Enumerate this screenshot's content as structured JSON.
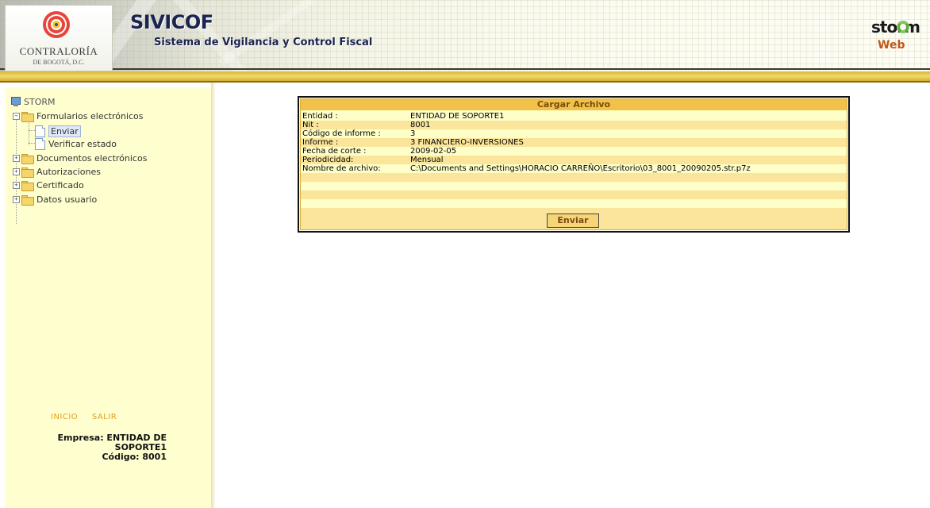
{
  "header": {
    "logo_name": "CONTRALORÍA",
    "logo_city": "DE BOGOTÁ, D.C.",
    "app_title": "SIVICOF",
    "app_subtitle": "Sistema de Vigilancia y Control Fiscal",
    "storm_word": "storm",
    "storm_web": "Web"
  },
  "sidebar": {
    "root": "STORM",
    "items": [
      {
        "label": "Formularios electrónicos",
        "icon": "folder-open-icon",
        "expanded": true
      },
      {
        "label": "Enviar",
        "icon": "document-icon",
        "selected": true
      },
      {
        "label": "Verificar estado",
        "icon": "document-icon"
      },
      {
        "label": "Documentos electrónicos",
        "icon": "folder-icon"
      },
      {
        "label": "Autorizaciones",
        "icon": "folder-icon"
      },
      {
        "label": "Certificado",
        "icon": "folder-icon"
      },
      {
        "label": "Datos usuario",
        "icon": "folder-icon"
      }
    ],
    "links": {
      "inicio": "INICIO",
      "salir": "SALIR"
    },
    "empresa_line1": "Empresa: ENTIDAD DE",
    "empresa_line2": "SOPORTE1",
    "codigo": "Código: 8001"
  },
  "panel": {
    "title": "Cargar Archivo",
    "rows": [
      {
        "label": "Entidad :",
        "value": "ENTIDAD DE SOPORTE1"
      },
      {
        "label": "Nit :",
        "value": "8001"
      },
      {
        "label": "Código de informe :",
        "value": "3"
      },
      {
        "label": "Informe :",
        "value": "3 FINANCIERO-INVERSIONES"
      },
      {
        "label": "Fecha de corte :",
        "value": "2009-02-05"
      },
      {
        "label": "Periodicidad:",
        "value": "Mensual"
      },
      {
        "label": "Nombre de archivo:",
        "value": "C:\\Documents and Settings\\HORACIO CARREÑO\\Escritorio\\03_8001_20090205.str.p7z"
      }
    ],
    "button": "Enviar"
  },
  "colors": {
    "sidebar_bg": "#fefecf",
    "panel_header": "#f2c14a",
    "panel_alt_row": "#fbe59a",
    "title_navy": "#1b2450",
    "link_orange": "#e0a020"
  }
}
